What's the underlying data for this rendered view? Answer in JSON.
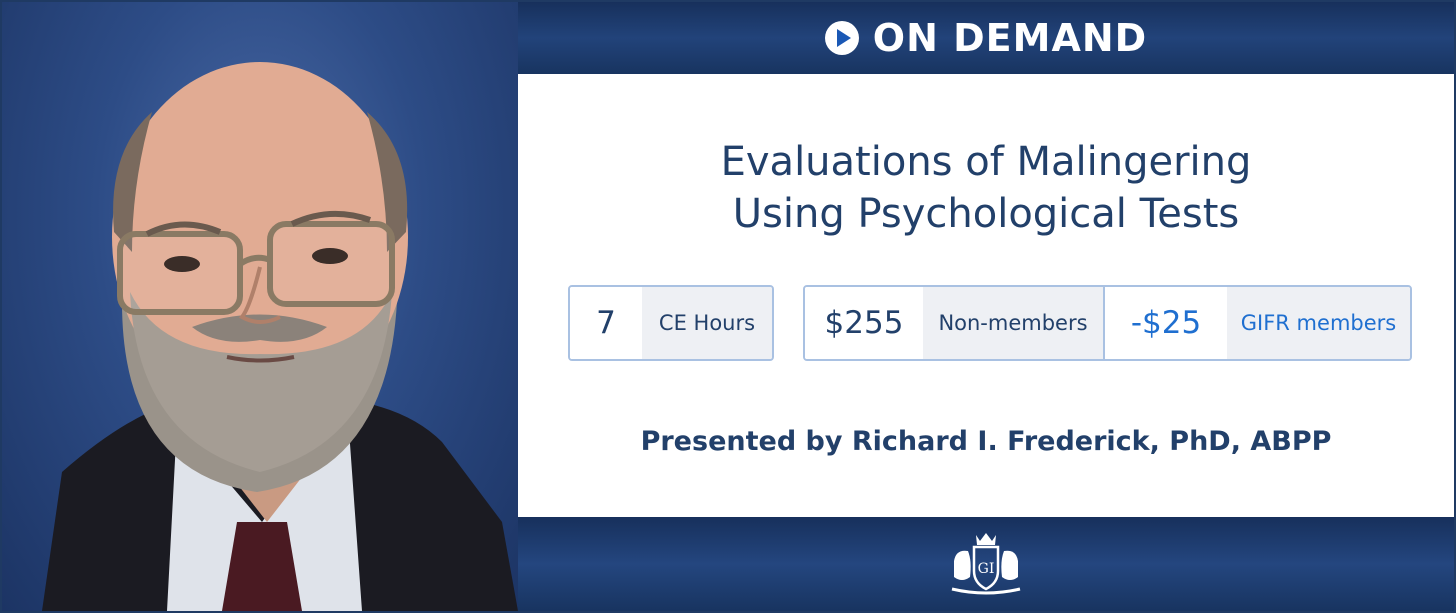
{
  "banner": {
    "top_bar": {
      "label": "ON DEMAND",
      "icon": "play-circle-icon"
    },
    "course": {
      "title_line_1": "Evaluations of Malingering",
      "title_line_2": "Using Psychological Tests"
    },
    "ce": {
      "value": "7",
      "label": "CE Hours"
    },
    "pricing": {
      "non_member_price": "$255",
      "non_member_label": "Non-members",
      "member_discount": "-$25",
      "member_label": "GIFR members"
    },
    "presenter": "Presented by Richard I. Frederick, PhD, ABPP",
    "logo": {
      "icon": "gifr-crest-logo",
      "monogram": "GI"
    }
  },
  "colors": {
    "navy": "#1f3a63",
    "title_text": "#22406a",
    "accent_blue": "#1f6fd0",
    "box_border": "#a9c1e2",
    "label_bg": "#eef0f4"
  }
}
